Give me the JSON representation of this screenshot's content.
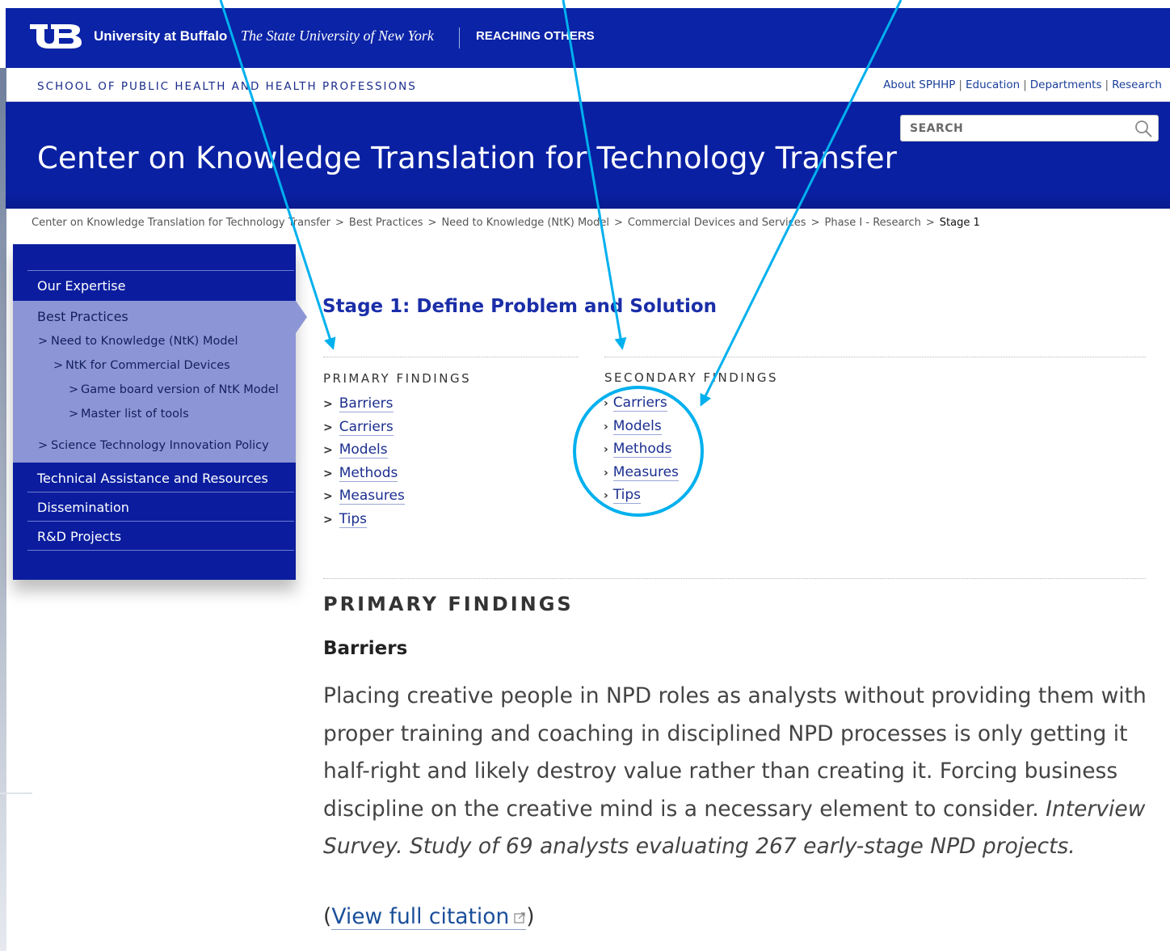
{
  "ub_bar": {
    "name": "University at Buffalo",
    "state": "The State University of New York",
    "tagline": "REACHING OTHERS"
  },
  "school_bar": {
    "name": "SCHOOL OF PUBLIC HEALTH AND HEALTH PROFESSIONS",
    "links": [
      "About SPHHP",
      "Education",
      "Departments",
      "Research"
    ],
    "separator": "|"
  },
  "banner": {
    "title": "Center on Knowledge Translation for Technology Transfer",
    "search_placeholder": "SEARCH"
  },
  "breadcrumb": {
    "items": [
      "Center on Knowledge Translation for Technology Transfer",
      "Best Practices",
      "Need to Knowledge (NtK) Model",
      "Commercial Devices and Services",
      "Phase I - Research"
    ],
    "current": "Stage 1",
    "arrow": ">"
  },
  "sidebar": {
    "our_expertise": "Our Expertise",
    "best_practices": "Best Practices",
    "ntk_model": "Need to Knowledge (NtK) Model",
    "ntk_commercial": "NtK for Commercial Devices",
    "game_board": "Game board version of NtK Model",
    "master_list": "Master list of tools",
    "science_policy": "Science Technology Innovation Policy",
    "technical_assistance": "Technical Assistance and Resources",
    "dissemination": "Dissemination",
    "rd_projects": "R&D Projects",
    "chevron": ">"
  },
  "main": {
    "stage_title": "Stage 1: Define Problem and Solution",
    "primary_heading": "PRIMARY FINDINGS",
    "primary_links": [
      "Barriers",
      "Carriers",
      "Models",
      "Methods",
      "Measures",
      "Tips"
    ],
    "secondary_heading": "SECONDARY FINDINGS",
    "secondary_links": [
      "Carriers",
      "Models",
      "Methods",
      "Measures",
      "Tips"
    ],
    "chevron": ">",
    "secondary_chevron": "›",
    "findings_heading": "PRIMARY FINDINGS",
    "barriers_title": "Barriers",
    "barriers_text": "Placing creative people in NPD roles as analysts without providing them with proper training and coaching in disciplined NPD processes is only getting it half-right and likely destroy value rather than creating it. Forcing business discipline on the creative mind is a necessary element to consider.",
    "barriers_cite": "Interview Survey. Study of 69 analysts evaluating 267 early-stage NPD projects.",
    "citation_open": "(",
    "citation_link": "View full citation",
    "citation_close": ")"
  },
  "colors": {
    "ub_blue": "#0b23a6",
    "sidebar_blue": "#0b1d9e",
    "sidebar_active": "#8c96d6",
    "annotation_cyan": "#00b0ee"
  }
}
